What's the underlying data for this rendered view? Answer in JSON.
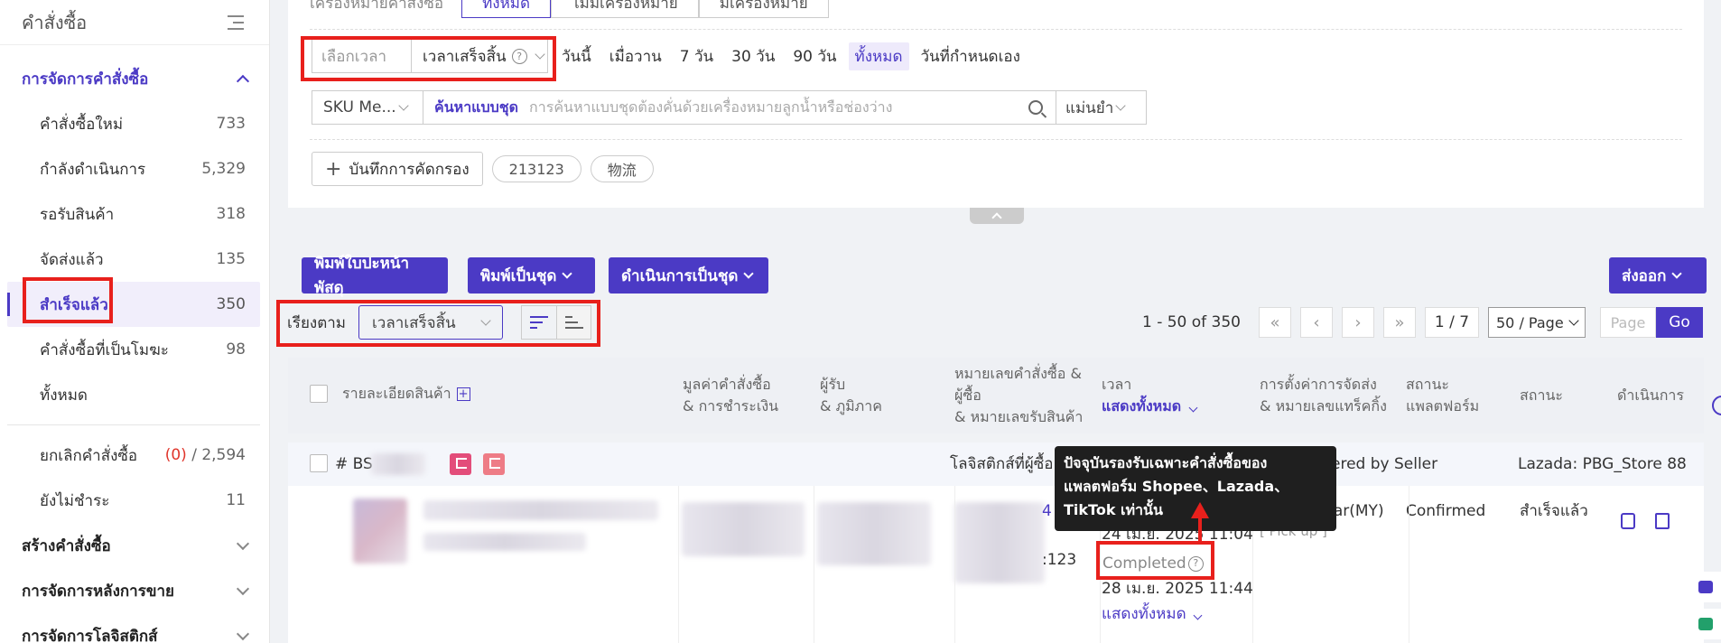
{
  "sidebar": {
    "title": "คำสั่งซื้อ",
    "group_order_mgmt": "การจัดการคำสั่งซื้อ",
    "items": [
      {
        "label": "คำสั่งซื้อใหม่",
        "count": "733"
      },
      {
        "label": "กำลังดำเนินการ",
        "count": "5,329"
      },
      {
        "label": "รอรับสินค้า",
        "count": "318"
      },
      {
        "label": "จัดส่งแล้ว",
        "count": "135"
      },
      {
        "label": "สำเร็จแล้ว",
        "count": "350"
      },
      {
        "label": "คำสั่งซื้อที่เป็นโมฆะ",
        "count": "98"
      },
      {
        "label": "ทั้งหมด",
        "count": ""
      }
    ],
    "cancel": {
      "label": "ยกเลิกคำสั่งซื้อ",
      "red": "(0)",
      "sep": "/",
      "count": "2,594"
    },
    "unpaid": {
      "label": "ยังไม่ชำระ",
      "count": "11"
    },
    "groups": [
      "สร้างคำสั่งซื้อ",
      "การจัดการหลังการขาย",
      "การจัดการโลจิสติกส์"
    ]
  },
  "filters": {
    "marker_label": "เครื่องหมายคำสั่งซื้อ",
    "marker_tabs": [
      "ทั้งหมด",
      "ไม่มีเครื่องหมาย",
      "มีเครื่องหมาย"
    ],
    "time_select_placeholder": "เลือกเวลา",
    "time_type": "เวลาเสร็จสิ้น",
    "quick_times": [
      "วันนี้",
      "เมื่อวาน",
      "7 วัน",
      "30 วัน",
      "90 วัน",
      "ทั้งหมด",
      "วันที่กำหนดเอง"
    ],
    "sku_select": "SKU Me...",
    "search_mode": "ค้นหาแบบชุด",
    "search_placeholder": "การค้นหาแบบชุดต้องคั่นด้วยเครื่องหมายลูกน้ำหรือช่องว่าง",
    "match": "แม่นยำ",
    "save_filter": "บันทึกการคัดกรอง",
    "saved_tags": [
      "213123",
      "物流"
    ]
  },
  "toolbar": {
    "print_label": "พิมพ์ใบปะหน้าพัสดุ",
    "print_batch": "พิมพ์เป็นชุด",
    "batch_action": "ดำเนินการเป็นชุด",
    "export": "ส่งออก",
    "sort_label": "เรียงตาม",
    "sort_value": "เวลาเสร็จสิ้น"
  },
  "pager": {
    "range": "1 - 50 of 350",
    "page": "1 / 7",
    "page_size": "50 / Page",
    "page_placeholder": "Page",
    "go": "Go"
  },
  "table": {
    "headers": {
      "product": "รายละเอียดสินค้า",
      "value_1": "มูลค่าคำสั่งซื้อ",
      "value_2": "& การชำระเงิน",
      "recipient_1": "ผู้รับ",
      "recipient_2": "& ภูมิภาค",
      "orderno_1": "หมายเลขคำสั่งซื้อ &",
      "orderno_2": "ผู้ซื้อ",
      "orderno_3": "& หมายเลขรับสินค้า",
      "time_1": "เวลา",
      "time_2": "แสดงทั้งหมด",
      "ship_1": "การตั้งค่าการจัดส่ง",
      "ship_2": "& หมายเลขแทร็คกิ้ง",
      "pstatus_1": "สถานะ",
      "pstatus_2": "แพลตฟอร์ม",
      "status": "สถานะ",
      "action": "ดำเนินการ"
    },
    "row": {
      "order_prefix": "# BS",
      "logistics": "โลจิสติกส์ที่ผู้ซื้อ",
      "delivered": "ered by Seller",
      "store": "Lazada: PBG_Store 88",
      "num_frag": "4",
      "num_frag2": ":123",
      "time_1": "24 เม.ย. 2025 11:04",
      "completed": "Completed",
      "time_2": "28 เม.ย. 2025 11:44",
      "show_all": "แสดงทั้งหมด",
      "carrier": "J&T Regular(MY)",
      "pickup": "[ Pick up ]",
      "platform_status": "Confirmed",
      "status": "สำเร็จแล้ว"
    }
  },
  "tooltip": {
    "line1": "ปัจจุบันรองรับเฉพาะคำสั่งซื้อของ",
    "line2": "แพลตฟอร์ม Shopee、Lazada、",
    "line3": "TikTok เท่านั้น"
  },
  "colors": {
    "accent": "#4b3ac5",
    "highlight": "#e8201c",
    "tooltip_bg": "#1f1f1f"
  }
}
